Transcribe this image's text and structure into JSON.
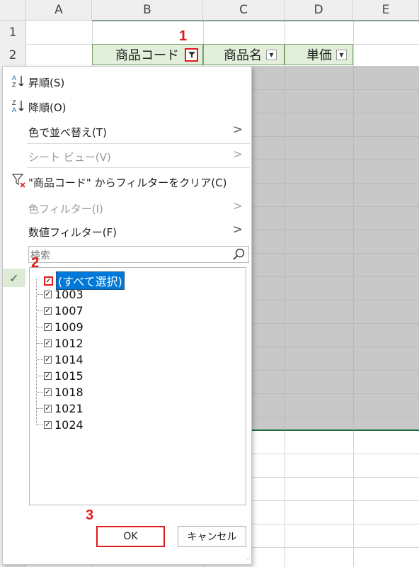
{
  "columns": [
    "A",
    "B",
    "C",
    "D",
    "E"
  ],
  "rows": [
    "1",
    "2"
  ],
  "header_cells": {
    "product_code": "商品コード",
    "product_name": "商品名",
    "unit_price": "単価"
  },
  "menu": {
    "sort_asc": "昇順(S)",
    "sort_desc": "降順(O)",
    "sort_by_color": "色で並べ替え(T)",
    "sheet_view": "シート ビュー(V)",
    "clear_filter": "\"商品コード\" からフィルターをクリア(C)",
    "color_filter": "色フィルター(I)",
    "number_filter": "数値フィルター(F)",
    "search_placeholder": "検索"
  },
  "filter_list": {
    "select_all": "(すべて選択)",
    "items": [
      "1003",
      "1007",
      "1009",
      "1012",
      "1014",
      "1015",
      "1018",
      "1021",
      "1024"
    ]
  },
  "buttons": {
    "ok": "OK",
    "cancel": "キャンセル"
  },
  "markers": {
    "m1": "1",
    "m2": "2",
    "m3": "3"
  },
  "colors": {
    "header_fill": "#e2efda",
    "selection": "#0078d7",
    "marker": "#e0191b",
    "grey_area": "#c8c8c8"
  }
}
